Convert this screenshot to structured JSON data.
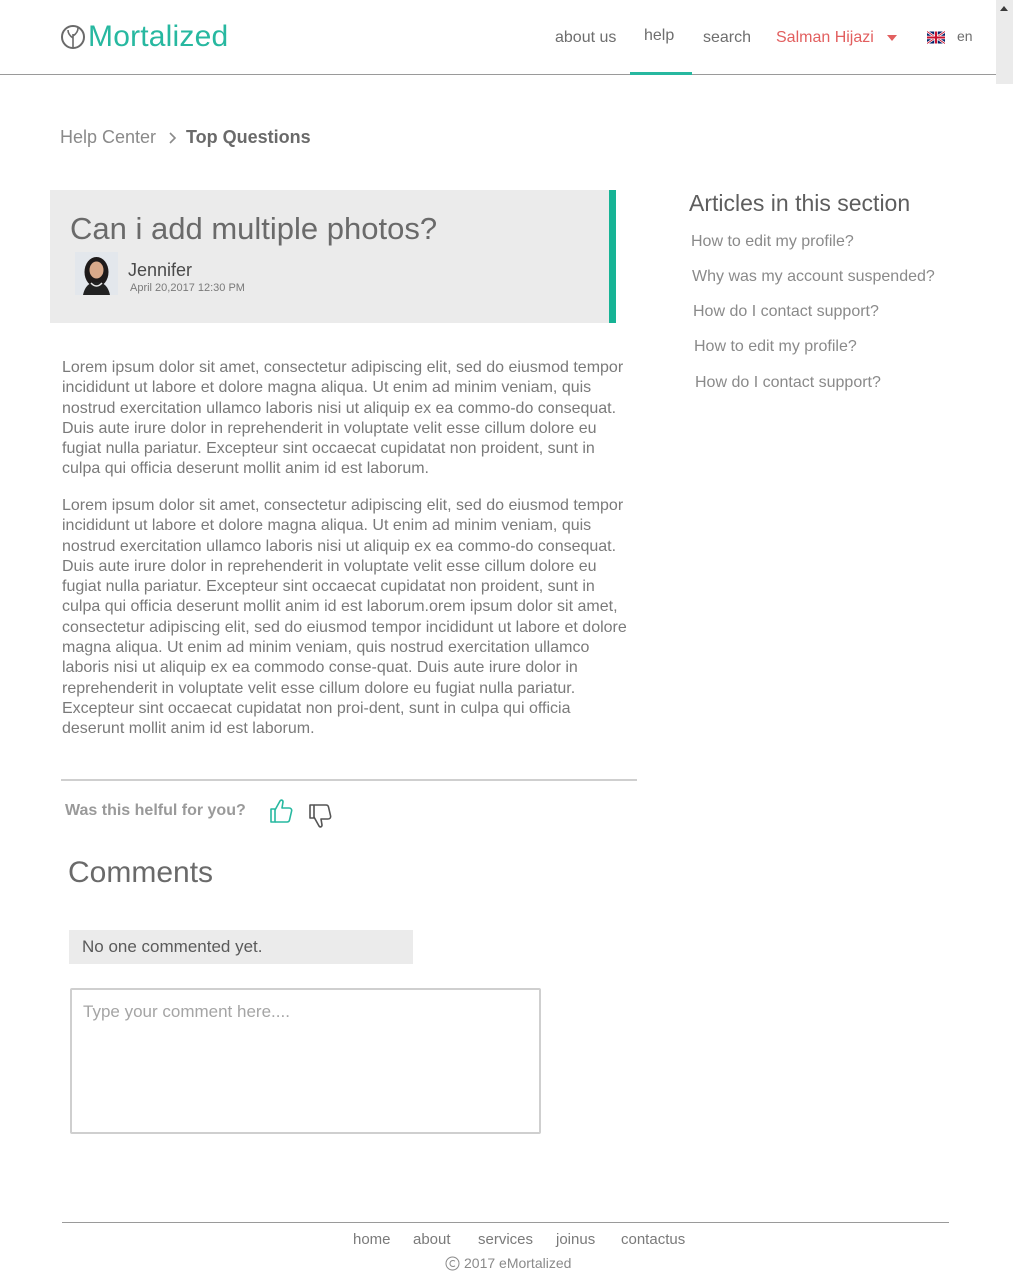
{
  "header": {
    "brand": "eMortalized",
    "brand_mark": "e",
    "brand_rest": "Mortalized",
    "nav": {
      "about_us": "about us",
      "help": "help",
      "search": "search"
    },
    "user_name": "Salman Hijazi",
    "language": "en",
    "language_flag_icon": "uk-flag-icon",
    "accent_color": "#27b8a0",
    "user_color": "#e25f5f"
  },
  "breadcrumb": {
    "home": "Help Center",
    "current": "Top Questions"
  },
  "question": {
    "title": "Can i add multiple photos?",
    "author": "Jennifer",
    "date": "April 20,2017  12:30 PM",
    "accent_color": "#16b395"
  },
  "article": {
    "paragraphs": [
      "Lorem ipsum dolor sit amet, consectetur adipiscing elit, sed do eiusmod tempor incididunt ut labore et dolore magna aliqua. Ut enim ad minim veniam, quis nostrud exercitation ullamco laboris nisi ut aliquip ex ea commo-do consequat. Duis aute irure dolor in reprehenderit in voluptate velit esse cillum dolore eu fugiat nulla pariatur. Excepteur sint occaecat cupidatat non proident, sunt in culpa qui officia deserunt mollit anim id est laborum.",
      "Lorem ipsum dolor sit amet, consectetur adipiscing elit, sed do eiusmod tempor incididunt ut labore et dolore magna aliqua. Ut enim ad minim veniam, quis nostrud exercitation ullamco laboris nisi ut aliquip ex ea commo-do consequat. Duis aute irure dolor in reprehenderit in voluptate velit esse cillum dolore eu fugiat nulla pariatur. Excepteur sint occaecat cupidatat non proident, sunt in culpa qui officia deserunt mollit anim id est laborum.orem ipsum dolor sit amet, consectetur adipiscing elit, sed do eiusmod tempor incididunt ut labore et dolore magna aliqua. Ut enim ad minim veniam, quis nostrud exercitation ullamco laboris nisi ut aliquip ex ea commodo conse-quat. Duis aute irure dolor in reprehenderit in voluptate velit esse cillum dolore eu fugiat nulla pariatur. Excepteur sint occaecat cupidatat non proi-dent, sunt in culpa qui officia deserunt mollit anim id est laborum."
    ]
  },
  "feedback": {
    "prompt": "Was this helful for you?",
    "like_icon": "thumbs-up-icon",
    "dislike_icon": "thumbs-down-icon"
  },
  "comments": {
    "heading": "Comments",
    "empty_message": "No one commented yet.",
    "input_value": "",
    "input_placeholder": "Type your comment here...."
  },
  "sidebar": {
    "heading": "Articles in this section",
    "articles": [
      "How to edit my profile?",
      "Why was my account suspended?",
      "How do I contact support?",
      "How to edit my profile?",
      "How do I contact support?"
    ]
  },
  "footer": {
    "links": [
      "home",
      "about",
      "services",
      "joinus",
      "contactus"
    ],
    "copyright": "2017 eMortalized"
  }
}
